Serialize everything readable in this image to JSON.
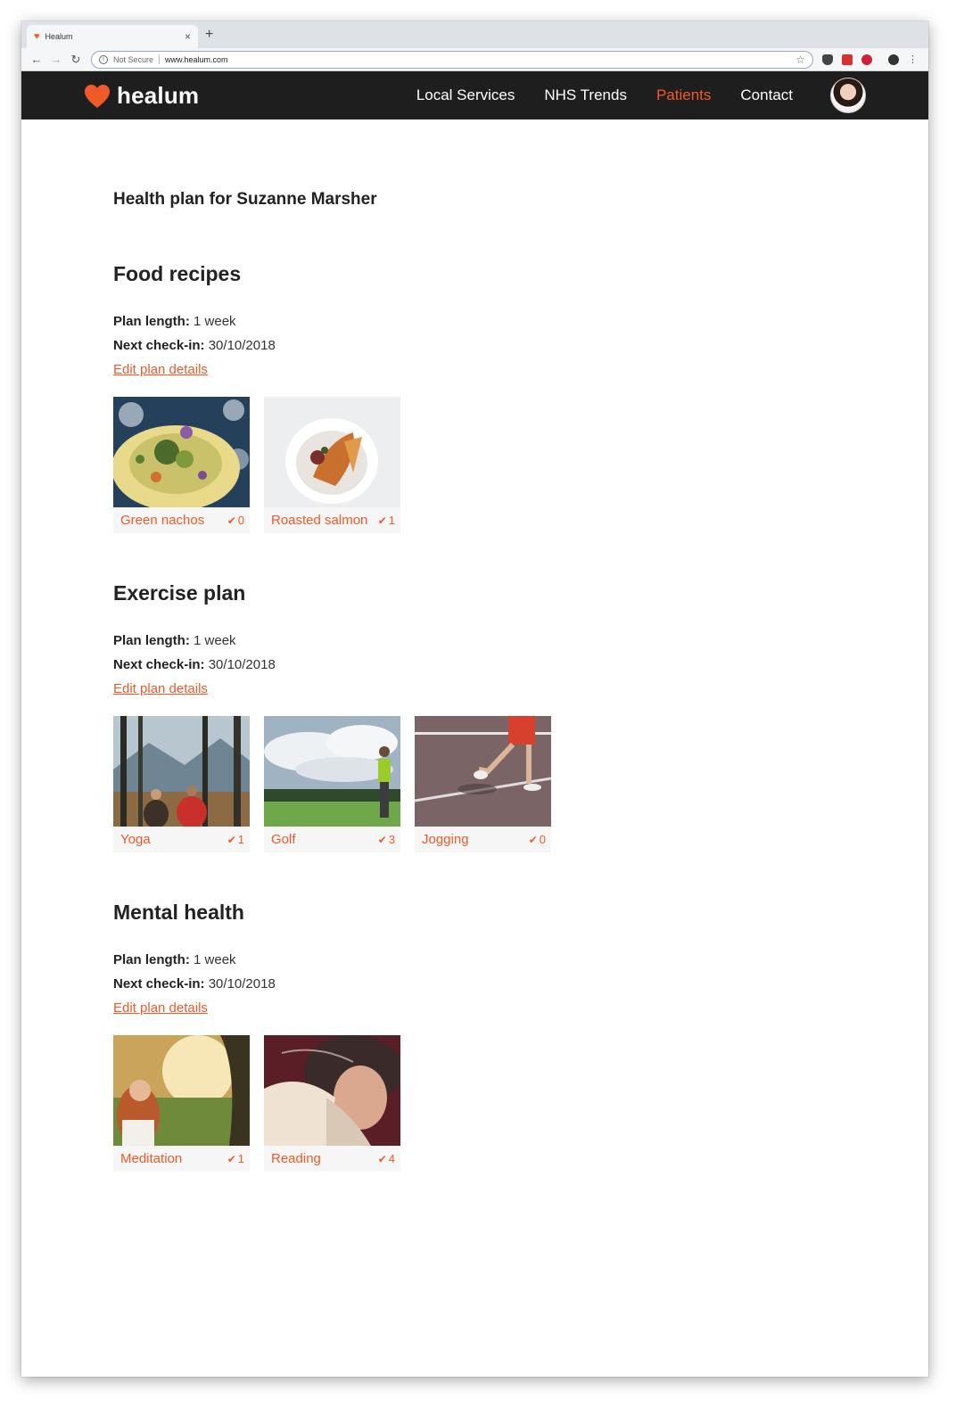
{
  "browser": {
    "tab_title": "Healum",
    "tab_close": "×",
    "new_tab": "+",
    "security_label": "Not Secure",
    "url": "www.healum.com"
  },
  "site": {
    "brand": "healum",
    "nav": [
      "Local Services",
      "NHS Trends",
      "Patients",
      "Contact"
    ],
    "active_nav": "Patients",
    "accent_color": "#f05a28",
    "header_bg": "#1e1e1e"
  },
  "page": {
    "title": "Health plan for Suzanne Marsher"
  },
  "labels": {
    "plan_length": "Plan length:",
    "next_checkin": "Next check-in:",
    "edit_link": "Edit plan details",
    "tick": "✔"
  },
  "sections": [
    {
      "title": "Food recipes",
      "plan_length": "1 week",
      "next_checkin": "30/10/2018",
      "items": [
        {
          "label": "Green nachos",
          "count": "0",
          "image": "salad-photo"
        },
        {
          "label": "Roasted salmon",
          "count": "1",
          "image": "salmon-bowl-photo"
        }
      ]
    },
    {
      "title": "Exercise plan",
      "plan_length": "1 week",
      "next_checkin": "30/10/2018",
      "items": [
        {
          "label": "Yoga",
          "count": "1",
          "image": "yoga-forest-photo"
        },
        {
          "label": "Golf",
          "count": "3",
          "image": "golf-course-photo"
        },
        {
          "label": "Jogging",
          "count": "0",
          "image": "jogging-track-photo"
        }
      ]
    },
    {
      "title": "Mental health",
      "plan_length": "1 week",
      "next_checkin": "30/10/2018",
      "items": [
        {
          "label": "Meditation",
          "count": "1",
          "image": "meditation-park-photo"
        },
        {
          "label": "Reading",
          "count": "4",
          "image": "reading-book-photo"
        }
      ]
    }
  ]
}
